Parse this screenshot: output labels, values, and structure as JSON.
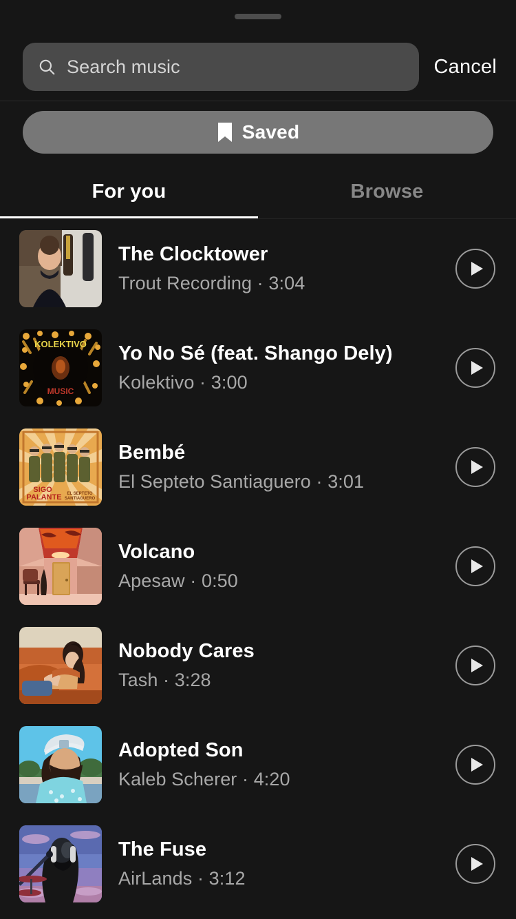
{
  "sheet": {
    "handle_name": "drag-handle"
  },
  "search": {
    "placeholder": "Search music",
    "value": "",
    "icon": "search-icon",
    "cancel_label": "Cancel"
  },
  "saved_button": {
    "label": "Saved",
    "icon": "bookmark-icon",
    "background": "#777777"
  },
  "tabs": {
    "active_index": 0,
    "items": [
      {
        "label": "For you"
      },
      {
        "label": "Browse"
      }
    ]
  },
  "tracks": [
    {
      "title": "The Clocktower",
      "artist": "Trout Recording",
      "duration": "3:04",
      "meta": "Trout Recording · 3:04",
      "play_icon": "play-icon",
      "art": "man-with-guitars-photo"
    },
    {
      "title": "Yo No Sé (feat. Shango Dely)",
      "artist": "Kolektivo",
      "duration": "3:00",
      "meta": "Kolektivo · 3:00",
      "play_icon": "play-icon",
      "art": "kolektivo-music-circle"
    },
    {
      "title": "Bembé",
      "artist": "El Septeto Santiaguero",
      "duration": "3:01",
      "meta": "El Septeto Santiaguero · 3:01",
      "play_icon": "play-icon",
      "art": "sigo-palante-band-sunburst"
    },
    {
      "title": "Volcano",
      "artist": "Apesaw",
      "duration": "0:50",
      "meta": "Apesaw · 0:50",
      "play_icon": "play-icon",
      "art": "pink-room-sunset-ceiling"
    },
    {
      "title": "Nobody Cares",
      "artist": "Tash",
      "duration": "3:28",
      "meta": "Tash · 3:28",
      "play_icon": "play-icon",
      "art": "woman-on-orange-couch"
    },
    {
      "title": "Adopted Son",
      "artist": "Kaleb Scherer",
      "duration": "4:20",
      "meta": "Kaleb Scherer · 4:20",
      "play_icon": "play-icon",
      "art": "bearded-man-white-cap-blue-sky"
    },
    {
      "title": "The Fuse",
      "artist": "AirLands",
      "duration": "3:12",
      "meta": "AirLands · 3:12",
      "play_icon": "play-icon",
      "art": "silhouette-purple-sky-microphone"
    }
  ],
  "colors": {
    "sheet_background": "#161616",
    "search_field": "#4a4a4a",
    "text_primary": "#ffffff",
    "text_secondary": "#a8a8a8",
    "tab_inactive": "#878787",
    "handle": "#4d4d4d"
  }
}
